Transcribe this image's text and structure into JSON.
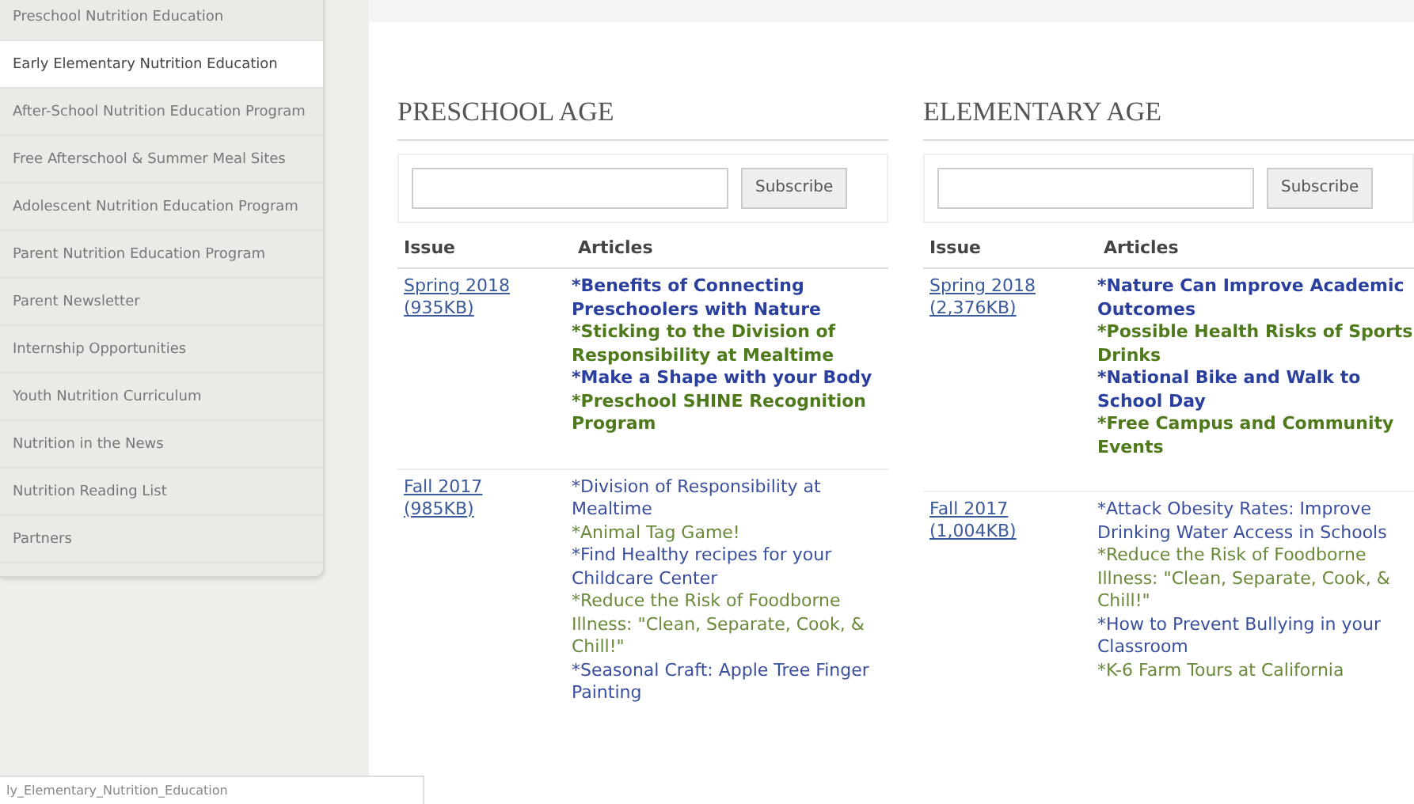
{
  "sidebar": {
    "items": [
      {
        "label": "Preschool Nutrition Education",
        "selected": false
      },
      {
        "label": "Early Elementary Nutrition Education",
        "selected": true
      },
      {
        "label": "After-School Nutrition Education Program",
        "selected": false
      },
      {
        "label": "Free Afterschool & Summer Meal Sites",
        "selected": false
      },
      {
        "label": "Adolescent Nutrition Education Program",
        "selected": false
      },
      {
        "label": "Parent Nutrition Education Program",
        "selected": false
      },
      {
        "label": "Parent Newsletter",
        "selected": false
      },
      {
        "label": "Internship Opportunities",
        "selected": false
      },
      {
        "label": "Youth Nutrition Curriculum",
        "selected": false
      },
      {
        "label": "Nutrition in the News",
        "selected": false
      },
      {
        "label": "Nutrition Reading List",
        "selected": false
      },
      {
        "label": "Partners",
        "selected": false
      }
    ]
  },
  "sections": [
    {
      "title": "PRESCHOOL AGE",
      "subscribe_button": "Subscribe",
      "columns": [
        "Issue",
        "Articles"
      ],
      "rows": [
        {
          "kind": "featured",
          "issue": [
            "Spring 2018",
            "(935KB)"
          ],
          "articles": [
            {
              "text": "*Benefits of Connecting Preschoolers with Nature",
              "color": "#2b3f9e"
            },
            {
              "text": "*Sticking to the Division of Responsibility at Mealtime",
              "color": "#4f7a1c"
            },
            {
              "text": "*Make a Shape with your Body",
              "color": "#2b3f9e"
            },
            {
              "text": "*Preschool SHINE Recognition Program",
              "color": "#4f7a1c"
            }
          ]
        },
        {
          "kind": "regular",
          "issue": [
            "Fall 2017",
            "(985KB)"
          ],
          "articles": [
            {
              "text": "*Division of Responsibility at Mealtime",
              "color": "#3a4f9e"
            },
            {
              "text": "*Animal Tag Game!",
              "color": "#6a8a3a"
            },
            {
              "text": "*Find Healthy recipes for your Childcare Center",
              "color": "#3a4f9e"
            },
            {
              "text": "*Reduce the Risk of Foodborne Illness: \"Clean, Separate, Cook, & Chill!\"",
              "color": "#6a8a3a"
            },
            {
              "text": "*Seasonal Craft: Apple Tree Finger Painting",
              "color": "#3a4f9e"
            }
          ]
        }
      ]
    },
    {
      "title": "ELEMENTARY AGE",
      "subscribe_button": "Subscribe",
      "columns": [
        "Issue",
        "Articles"
      ],
      "rows": [
        {
          "kind": "featured",
          "issue": [
            "Spring 2018",
            "(2,376KB)"
          ],
          "articles": [
            {
              "text": "*Nature Can Improve Academic Outcomes",
              "color": "#2b3f9e"
            },
            {
              "text": "*Possible Health Risks of Sports Drinks",
              "color": "#4f7a1c"
            },
            {
              "text": "*National Bike and Walk to School Day",
              "color": "#2b3f9e"
            },
            {
              "text": "*Free Campus and Community Events",
              "color": "#4f7a1c"
            }
          ]
        },
        {
          "kind": "regular",
          "issue": [
            "Fall 2017",
            "(1,004KB)"
          ],
          "articles": [
            {
              "text": "*Attack Obesity Rates: Improve Drinking Water Access in Schools",
              "color": "#3a4f9e"
            },
            {
              "text": "*Reduce the Risk of Foodborne Illness: \"Clean, Separate, Cook, & Chill!\"",
              "color": "#6a8a3a"
            },
            {
              "text": "*How to Prevent Bullying in your Classroom",
              "color": "#3a4f9e"
            },
            {
              "text": "*K-6 Farm Tours at California",
              "color": "#6a8a3a"
            }
          ]
        }
      ]
    }
  ],
  "status_bar": {
    "url": "ly_Elementary_Nutrition_Education"
  }
}
